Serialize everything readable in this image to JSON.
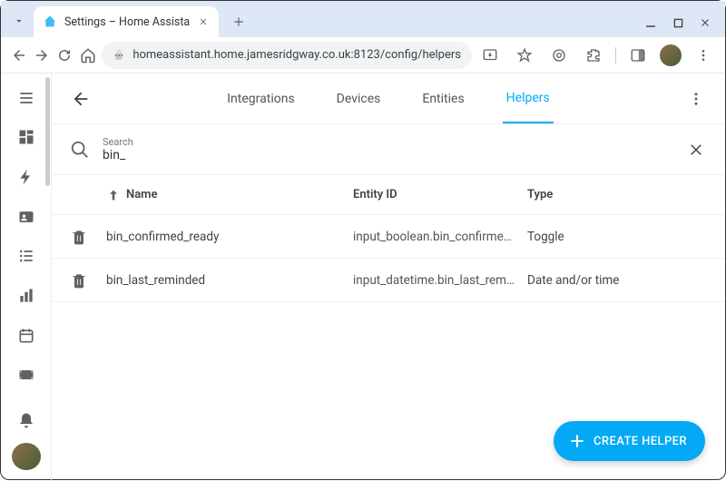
{
  "browser": {
    "tab_title": "Settings – Home Assista",
    "url": "homeassistant.home.jamesridgway.co.uk:8123/config/helpers"
  },
  "tabs": {
    "integrations": "Integrations",
    "devices": "Devices",
    "entities": "Entities",
    "helpers": "Helpers"
  },
  "search": {
    "label": "Search",
    "value": "bin_"
  },
  "columns": {
    "name": "Name",
    "entity_id": "Entity ID",
    "type": "Type"
  },
  "rows": [
    {
      "name": "bin_confirmed_ready",
      "entity_id": "input_boolean.bin_confirmed_re…",
      "type": "Toggle"
    },
    {
      "name": "bin_last_reminded",
      "entity_id": "input_datetime.bin_last_reminded",
      "type": "Date and/or time"
    }
  ],
  "fab": {
    "label": "CREATE HELPER"
  }
}
